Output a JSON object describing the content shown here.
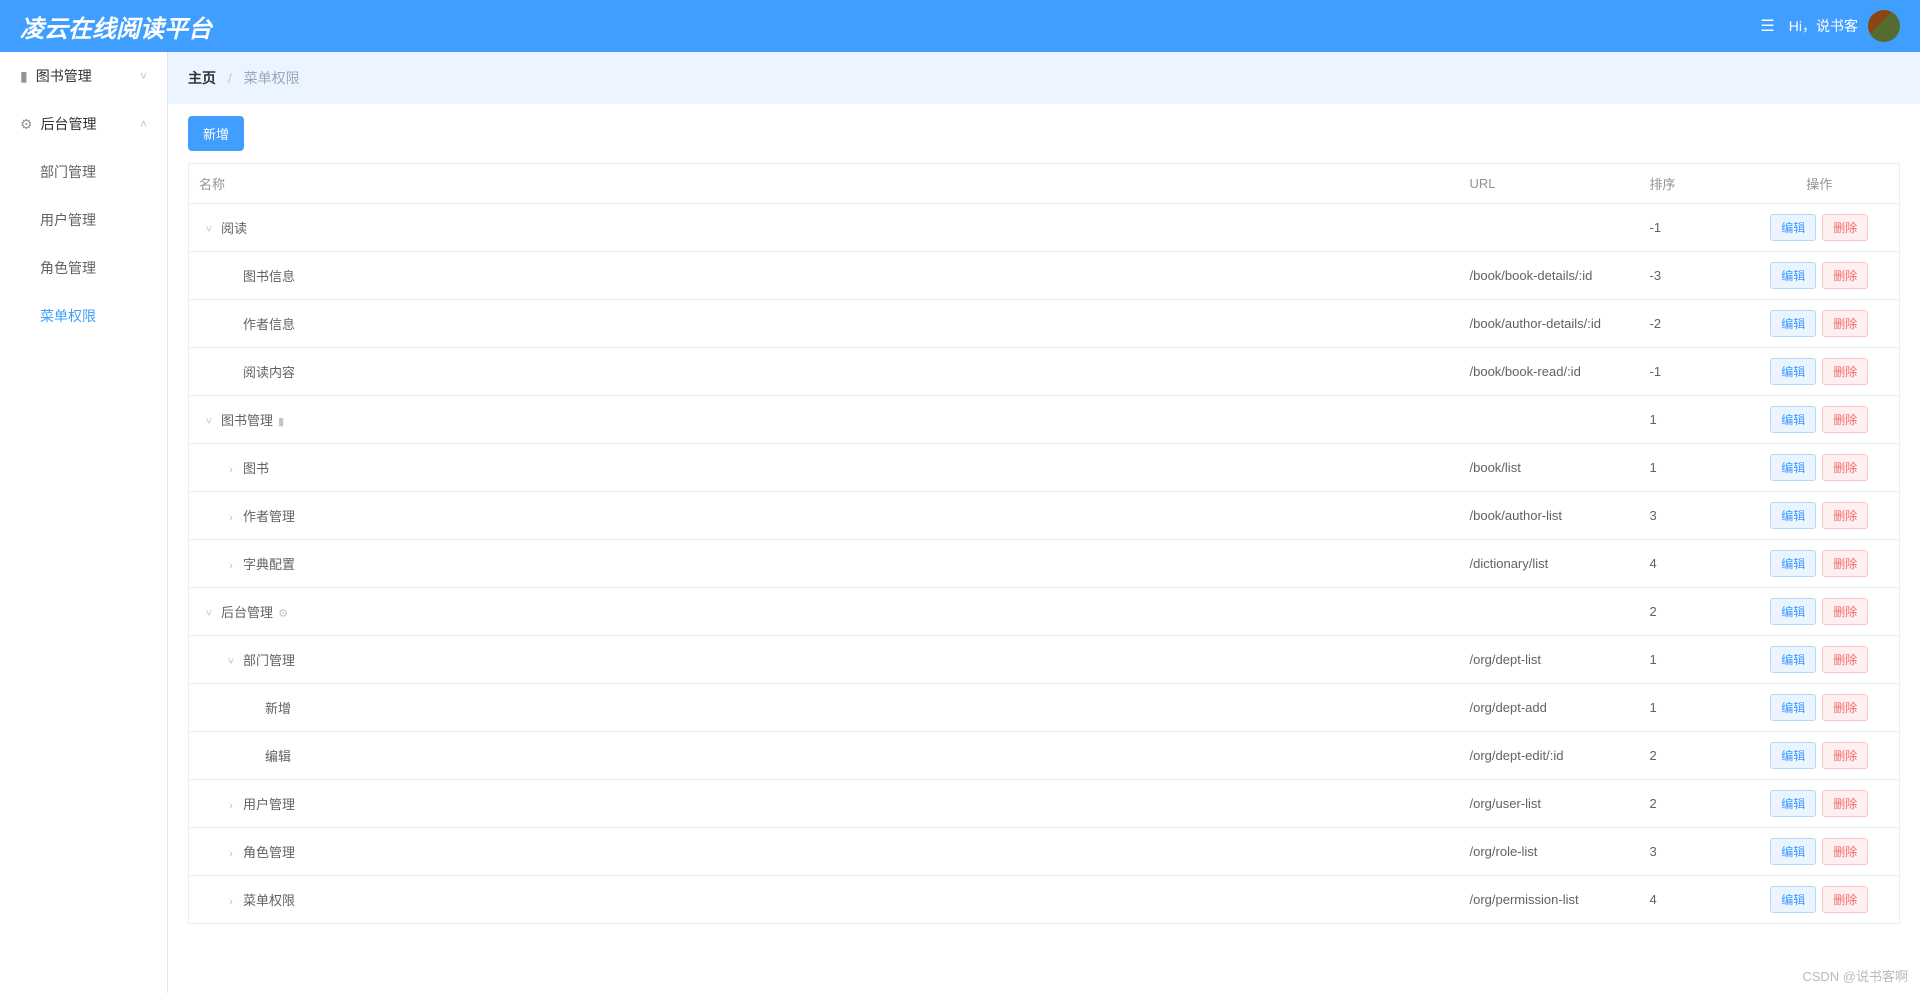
{
  "header": {
    "logo": "凌云在线阅读平台",
    "greeting": "Hi，说书客"
  },
  "sidebar": {
    "items": [
      {
        "label": "图书管理",
        "icon": "▮",
        "expanded": false,
        "type": "group"
      },
      {
        "label": "后台管理",
        "icon": "⚙",
        "expanded": true,
        "type": "group"
      },
      {
        "label": "部门管理",
        "type": "sub"
      },
      {
        "label": "用户管理",
        "type": "sub"
      },
      {
        "label": "角色管理",
        "type": "sub"
      },
      {
        "label": "菜单权限",
        "type": "sub",
        "active": true
      }
    ]
  },
  "breadcrumb": {
    "home": "主页",
    "current": "菜单权限"
  },
  "toolbar": {
    "add_label": "新增"
  },
  "table": {
    "headers": {
      "name": "名称",
      "url": "URL",
      "sort": "排序",
      "op": "操作"
    },
    "edit_label": "编辑",
    "delete_label": "删除",
    "rows": [
      {
        "indent": 0,
        "toggle": "v",
        "name": "阅读",
        "url": "",
        "sort": "-1",
        "extra": ""
      },
      {
        "indent": 1,
        "toggle": "",
        "name": "图书信息",
        "url": "/book/book-details/:id",
        "sort": "-3",
        "extra": ""
      },
      {
        "indent": 1,
        "toggle": "",
        "name": "作者信息",
        "url": "/book/author-details/:id",
        "sort": "-2",
        "extra": ""
      },
      {
        "indent": 1,
        "toggle": "",
        "name": "阅读内容",
        "url": "/book/book-read/:id",
        "sort": "-1",
        "extra": ""
      },
      {
        "indent": 0,
        "toggle": "v",
        "name": "图书管理",
        "url": "",
        "sort": "1",
        "extra": "▮"
      },
      {
        "indent": 1,
        "toggle": ">",
        "name": "图书",
        "url": "/book/list",
        "sort": "1",
        "extra": ""
      },
      {
        "indent": 1,
        "toggle": ">",
        "name": "作者管理",
        "url": "/book/author-list",
        "sort": "3",
        "extra": ""
      },
      {
        "indent": 1,
        "toggle": ">",
        "name": "字典配置",
        "url": "/dictionary/list",
        "sort": "4",
        "extra": ""
      },
      {
        "indent": 0,
        "toggle": "v",
        "name": "后台管理",
        "url": "",
        "sort": "2",
        "extra": "⚙"
      },
      {
        "indent": 1,
        "toggle": "v",
        "name": "部门管理",
        "url": "/org/dept-list",
        "sort": "1",
        "extra": ""
      },
      {
        "indent": 2,
        "toggle": "",
        "name": "新增",
        "url": "/org/dept-add",
        "sort": "1",
        "extra": ""
      },
      {
        "indent": 2,
        "toggle": "",
        "name": "编辑",
        "url": "/org/dept-edit/:id",
        "sort": "2",
        "extra": ""
      },
      {
        "indent": 1,
        "toggle": ">",
        "name": "用户管理",
        "url": "/org/user-list",
        "sort": "2",
        "extra": ""
      },
      {
        "indent": 1,
        "toggle": ">",
        "name": "角色管理",
        "url": "/org/role-list",
        "sort": "3",
        "extra": ""
      },
      {
        "indent": 1,
        "toggle": ">",
        "name": "菜单权限",
        "url": "/org/permission-list",
        "sort": "4",
        "extra": ""
      }
    ]
  },
  "watermark": "CSDN @说书客啊"
}
